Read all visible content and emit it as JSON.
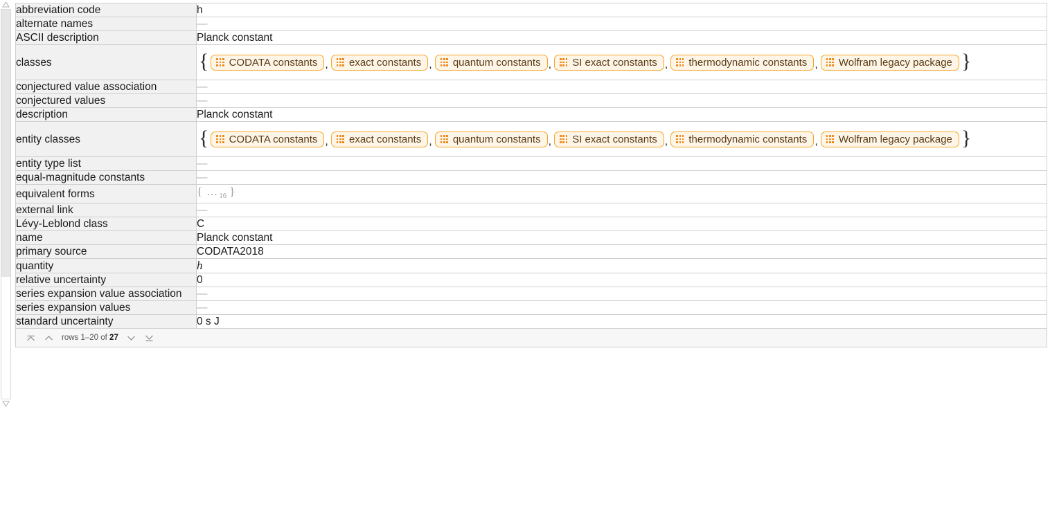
{
  "scrollbar": {
    "up_arrow": "scroll-up-triangle",
    "down_arrow": "scroll-down-triangle"
  },
  "table": {
    "rows": [
      {
        "label": "abbreviation code",
        "value": "h",
        "type": "text"
      },
      {
        "label": "alternate names",
        "value": "—",
        "type": "dash"
      },
      {
        "label": "ASCII description",
        "value": "Planck constant",
        "type": "text"
      },
      {
        "label": "classes",
        "type": "chips"
      },
      {
        "label": "conjectured value association",
        "value": "—",
        "type": "dash"
      },
      {
        "label": "conjectured values",
        "value": "—",
        "type": "dash"
      },
      {
        "label": "description",
        "value": "Planck constant",
        "type": "text"
      },
      {
        "label": "entity classes",
        "type": "chips"
      },
      {
        "label": "entity type list",
        "value": "—",
        "type": "dash"
      },
      {
        "label": "equal-magnitude constants",
        "value": "—",
        "type": "dash"
      },
      {
        "label": "equivalent forms",
        "type": "elided"
      },
      {
        "label": "external link",
        "value": "—",
        "type": "dash"
      },
      {
        "label": "Lévy-Leblond class",
        "value": "C",
        "type": "text"
      },
      {
        "label": "name",
        "value": "Planck constant",
        "type": "text"
      },
      {
        "label": "primary source",
        "value": "CODATA2018",
        "type": "text"
      },
      {
        "label": "quantity",
        "value": "h",
        "type": "italic"
      },
      {
        "label": "relative uncertainty",
        "value": "0",
        "type": "text"
      },
      {
        "label": "series expansion value association",
        "value": "—",
        "type": "dash"
      },
      {
        "label": "series expansion values",
        "value": "—",
        "type": "dash"
      },
      {
        "label": "standard uncertainty",
        "value": "0 s J",
        "type": "text"
      }
    ],
    "chips": [
      "CODATA constants",
      "exact constants",
      "quantum constants",
      "SI exact constants",
      "thermodynamic constants",
      "Wolfram legacy package"
    ],
    "chip_icon": "dot-grid-icon",
    "brace_open": "{",
    "brace_close": "}",
    "separator": ",",
    "elided": {
      "open": "{",
      "dots": "…",
      "count": "16",
      "close": "}"
    }
  },
  "pagination": {
    "first_label": "jump-to-first",
    "prev_label": "previous-page",
    "text_prefix": "rows 1–20 of ",
    "total": "27",
    "next_label": "next-page",
    "last_label": "jump-to-last"
  },
  "colors": {
    "chip_border": "#f5a623",
    "chip_bg": "#fdf6e8",
    "chip_text": "#5a3a14",
    "chip_dots": "#f08c1b",
    "label_bg": "#f1f1f1",
    "grid_line": "#cfcfcf",
    "footer_bg": "#f7f7f7"
  }
}
